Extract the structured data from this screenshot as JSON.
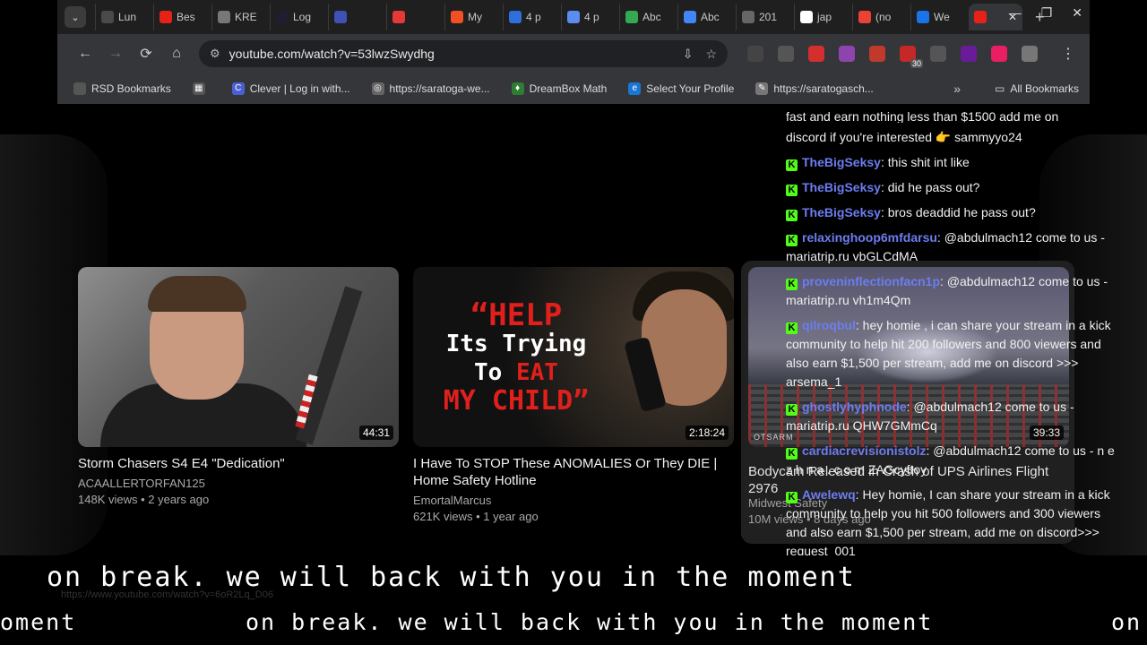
{
  "tabs": [
    {
      "label": "Lun",
      "color": "#4a4a4a"
    },
    {
      "label": "Bes",
      "color": "#e62117"
    },
    {
      "label": "KRE",
      "color": "#777777"
    },
    {
      "label": "Log",
      "color": "#1e1e2e"
    },
    {
      "label": "",
      "color": "#3f51b5"
    },
    {
      "label": "",
      "color": "#e53935"
    },
    {
      "label": "My",
      "color": "#f25022"
    },
    {
      "label": "4 p",
      "color": "#2e6fdb"
    },
    {
      "label": "4 p",
      "color": "#5a8dee"
    },
    {
      "label": "Abc",
      "color": "#34a853"
    },
    {
      "label": "Abc",
      "color": "#4285f4"
    },
    {
      "label": "201",
      "color": "#666666"
    },
    {
      "label": "jap",
      "color": "#ffffff"
    },
    {
      "label": "(no",
      "color": "#ea4335"
    },
    {
      "label": "We",
      "color": "#1a73e8"
    }
  ],
  "window": {
    "minimize": "—",
    "maximize": "❐",
    "close": "✕",
    "new_tab": "+"
  },
  "toolbar": {
    "url": "youtube.com/watch?v=53lwzSwydhg",
    "back": "←",
    "forward": "→",
    "reload": "⟳",
    "home": "⌂",
    "menu": "⋮"
  },
  "extensions": [
    {
      "color": "#444444",
      "badge": ""
    },
    {
      "color": "#555555",
      "badge": ""
    },
    {
      "color": "#d32f2f",
      "badge": ""
    },
    {
      "color": "#8e44ad",
      "badge": ""
    },
    {
      "color": "#c0392b",
      "badge": ""
    },
    {
      "color": "#c62828",
      "badge": "30"
    },
    {
      "color": "#555555",
      "badge": ""
    },
    {
      "color": "#6a1b9a",
      "badge": ""
    },
    {
      "color": "#e91e63",
      "badge": ""
    },
    {
      "color": "#777777",
      "badge": ""
    }
  ],
  "bookmarks": {
    "items": [
      {
        "label": "RSD Bookmarks",
        "color": "#555555",
        "glyph": ""
      },
      {
        "label": "",
        "color": "#555555",
        "glyph": "▦"
      },
      {
        "label": "Clever | Log in with...",
        "color": "#4b61d1",
        "glyph": "C"
      },
      {
        "label": "https://saratoga-we...",
        "color": "#666666",
        "glyph": "◎"
      },
      {
        "label": "DreamBox Math",
        "color": "#2e7d32",
        "glyph": "♦"
      },
      {
        "label": "Select Your Profile",
        "color": "#1976d2",
        "glyph": "e"
      },
      {
        "label": "https://saratogasch...",
        "color": "#777777",
        "glyph": "✎"
      }
    ],
    "more": "»",
    "all": "All Bookmarks"
  },
  "videos": [
    {
      "title": "Storm Chasers S4 E4 \"Dedication\"",
      "channel": "ACAALLERTORFAN125",
      "meta": "148K views • 2 years ago",
      "duration": "44:31"
    },
    {
      "title": "I Have To STOP These ANOMALIES Or They DIE | Home Safety Hotline",
      "channel": "EmortalMarcus",
      "meta": "621K views • 1 year ago",
      "duration": "2:18:24",
      "thumb_text": {
        "l1": "“HELP",
        "l2": "Its Trying",
        "l3a": "To ",
        "l3b": "EAT",
        "l4": "MY CHILD”"
      }
    },
    {
      "title": "Bodycam Released in Crash of UPS Airlines Flight 2976",
      "channel": "Midwest Safety",
      "meta": "10M views • 8 days ago",
      "duration": "39:33",
      "logo": "OTSARM"
    }
  ],
  "chat": {
    "partial_top": "fast and earn nothing less than $1500 add me on",
    "lead": "discord if you're interested 👉 sammyyo24",
    "messages": [
      {
        "user": "TheBigSeksy",
        "text": "this shit int like"
      },
      {
        "user": "TheBigSeksy",
        "text": "did he pass out?"
      },
      {
        "user": "TheBigSeksy",
        "text": "bros deaddid he pass out?"
      },
      {
        "user": "relaxinghoop6mfdarsu",
        "text": "@abdulmach12 come to us - mariatrip.ru vbGLCdMA"
      },
      {
        "user": "proveninflectionfacn1p",
        "text": "@abdulmach12 come to us - mariatrip.ru vh1m4Qm"
      },
      {
        "user": "qilroqbul",
        "text": "hey homie , i can share your stream in a kick community to help hit 200 followers and 800 viewers and also earn $1,500 per stream, add me on discord >>> arsema_1"
      },
      {
        "user": "ghostlyhyphnode",
        "text": "@abdulmach12 come to us - mariatrip.ru QHW7GMmCq"
      },
      {
        "user": "cardiacrevisionistolz",
        "text": "@abdulmach12 come to us - n e z h n a . c o m ZAGcyftoy"
      },
      {
        "user": "Awelewq",
        "text": "Hey homie, I can share your stream in a kick community to help you hit 500 followers and 300 viewers and also earn $1,500 per stream, add me on discord>>> request_001"
      }
    ]
  },
  "ticker": {
    "line1": "on break. we will back with you in the moment",
    "ghost_url": "https://www.youtube.com/watch?v=6oR2Lq_D06",
    "line2_left": "oment",
    "line2_mid": "on break. we will back with you in the moment",
    "line2_right": "on"
  }
}
